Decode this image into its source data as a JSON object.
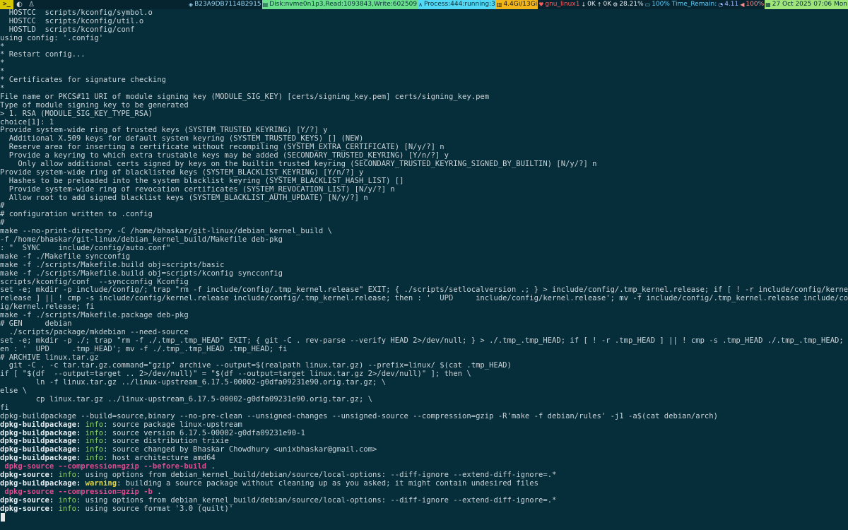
{
  "topbar": {
    "workspace": ">_",
    "status": {
      "host_id": "B23A9DB7114B2915",
      "disk": "Disk:nvme0n1p3,Read:1093843,Write:602509",
      "process": "Process:444:running:3",
      "memory": "4.4Gi/13Gi",
      "net_iface": "gnu_linux1",
      "net_down": "0K",
      "net_up": "0K",
      "cpu": "28.21%",
      "battery": "100% Time_Remain:",
      "load": "4.11",
      "volume": "100%",
      "datetime": "27 Oct 2025 07:06 Mon"
    }
  },
  "terminal": {
    "lines": [
      [
        {
          "t": "  HOSTCC  scripts/kconfig/symbol.o"
        }
      ],
      [
        {
          "t": "  HOSTCC  scripts/kconfig/util.o"
        }
      ],
      [
        {
          "t": "  HOSTLD  scripts/kconfig/conf"
        }
      ],
      [
        {
          "t": "using config: '.config'"
        }
      ],
      [
        {
          "t": "*"
        }
      ],
      [
        {
          "t": "* Restart config..."
        }
      ],
      [
        {
          "t": "*"
        }
      ],
      [
        {
          "t": "*"
        }
      ],
      [
        {
          "t": "* Certificates for signature checking"
        }
      ],
      [
        {
          "t": "*"
        }
      ],
      [
        {
          "t": "File name or PKCS#11 URI of module signing key (MODULE_SIG_KEY) [certs/signing_key.pem] certs/signing_key.pem"
        }
      ],
      [
        {
          "t": "Type of module signing key to be generated"
        }
      ],
      [
        {
          "t": "> 1. RSA (MODULE_SIG_KEY_TYPE_RSA)"
        }
      ],
      [
        {
          "t": "choice[1]: 1"
        }
      ],
      [
        {
          "t": "Provide system-wide ring of trusted keys (SYSTEM_TRUSTED_KEYRING) [Y/?] y"
        }
      ],
      [
        {
          "t": "  Additional X.509 keys for default system keyring (SYSTEM_TRUSTED_KEYS) [] (NEW)"
        }
      ],
      [
        {
          "t": "  Reserve area for inserting a certificate without recompiling (SYSTEM_EXTRA_CERTIFICATE) [N/y/?] n"
        }
      ],
      [
        {
          "t": "  Provide a keyring to which extra trustable keys may be added (SECONDARY_TRUSTED_KEYRING) [Y/n/?] y"
        }
      ],
      [
        {
          "t": "    Only allow additional certs signed by keys on the builtin trusted keyring (SECONDARY_TRUSTED_KEYRING_SIGNED_BY_BUILTIN) [N/y/?] n"
        }
      ],
      [
        {
          "t": "Provide system-wide ring of blacklisted keys (SYSTEM_BLACKLIST_KEYRING) [Y/n/?] y"
        }
      ],
      [
        {
          "t": "  Hashes to be preloaded into the system blacklist keyring (SYSTEM_BLACKLIST_HASH_LIST) []"
        }
      ],
      [
        {
          "t": "  Provide system-wide ring of revocation certificates (SYSTEM_REVOCATION_LIST) [N/y/?] n"
        }
      ],
      [
        {
          "t": "  Allow root to add signed blacklist keys (SYSTEM_BLACKLIST_AUTH_UPDATE) [N/y/?] n"
        }
      ],
      [
        {
          "t": "#"
        }
      ],
      [
        {
          "t": "# configuration written to .config"
        }
      ],
      [
        {
          "t": "#"
        }
      ],
      [
        {
          "t": "make --no-print-directory -C /home/bhaskar/git-linux/debian_kernel_build \\"
        }
      ],
      [
        {
          "t": "-f /home/bhaskar/git-linux/debian_kernel_build/Makefile deb-pkg"
        }
      ],
      [
        {
          "t": ": \"  SYNC    include/config/auto.conf\""
        }
      ],
      [
        {
          "t": "make -f ./Makefile syncconfig"
        }
      ],
      [
        {
          "t": "make -f ./scripts/Makefile.build obj=scripts/basic"
        }
      ],
      [
        {
          "t": "make -f ./scripts/Makefile.build obj=scripts/kconfig syncconfig"
        }
      ],
      [
        {
          "t": "scripts/kconfig/conf  --syncconfig Kconfig"
        }
      ],
      [
        {
          "t": "set -e; mkdir -p include/config/; trap \"rm -f include/config/.tmp_kernel.release\" EXIT; { ./scripts/setlocalversion .; } > include/config/.tmp_kernel.release; if [ ! -r include/config/kernel."
        }
      ],
      [
        {
          "t": "release ] || ! cmp -s include/config/kernel.release include/config/.tmp_kernel.release; then : '  UPD     include/config/kernel.release'; mv -f include/config/.tmp_kernel.release include/conf"
        }
      ],
      [
        {
          "t": "ig/kernel.release; fi"
        }
      ],
      [
        {
          "t": "make -f ./scripts/Makefile.package deb-pkg"
        }
      ],
      [
        {
          "t": "# GEN     debian"
        }
      ],
      [
        {
          "t": "  ./scripts/package/mkdebian --need-source"
        }
      ],
      [
        {
          "t": "set -e; mkdir -p ./; trap \"rm -f ./.tmp_.tmp_HEAD\" EXIT; { git -C . rev-parse --verify HEAD 2>/dev/null; } > ./.tmp_.tmp_HEAD; if [ ! -r .tmp_HEAD ] || ! cmp -s .tmp_HEAD ./.tmp_.tmp_HEAD; th"
        }
      ],
      [
        {
          "t": "en : '  UPD     .tmp_HEAD'; mv -f ./.tmp_.tmp_HEAD .tmp_HEAD; fi"
        }
      ],
      [
        {
          "t": "# ARCHIVE linux.tar.gz"
        }
      ],
      [
        {
          "t": "  git -C . -c tar.tar.gz.command=\"gzip\" archive --output=$(realpath linux.tar.gz) --prefix=linux/ $(cat .tmp_HEAD)"
        }
      ],
      [
        {
          "t": "if [ \"$(df  --output=target .. 2>/dev/null)\" = \"$(df --output=target linux.tar.gz 2>/dev/null)\" ]; then \\"
        }
      ],
      [
        {
          "t": "        ln -f linux.tar.gz ../linux-upstream_6.17.5-00002-g0dfa09231e90.orig.tar.gz; \\"
        }
      ],
      [
        {
          "t": "else \\"
        }
      ],
      [
        {
          "t": "        cp linux.tar.gz ../linux-upstream_6.17.5-00002-g0dfa09231e90.orig.tar.gz; \\"
        }
      ],
      [
        {
          "t": "fi"
        }
      ],
      [
        {
          "t": "dpkg-buildpackage --build=source,binary --no-pre-clean --unsigned-changes --unsigned-source --compression=gzip -R'make -f debian/rules' -j1 -a$(cat debian/arch)"
        }
      ],
      [
        {
          "t": "dpkg-buildpackage:",
          "s": "src"
        },
        {
          "t": " "
        },
        {
          "t": "info",
          "s": "info"
        },
        {
          "t": ": source package linux-upstream"
        }
      ],
      [
        {
          "t": "dpkg-buildpackage:",
          "s": "src"
        },
        {
          "t": " "
        },
        {
          "t": "info",
          "s": "info"
        },
        {
          "t": ": source version 6.17.5-00002-g0dfa09231e90-1"
        }
      ],
      [
        {
          "t": "dpkg-buildpackage:",
          "s": "src"
        },
        {
          "t": " "
        },
        {
          "t": "info",
          "s": "info"
        },
        {
          "t": ": source distribution trixie"
        }
      ],
      [
        {
          "t": "dpkg-buildpackage:",
          "s": "src"
        },
        {
          "t": " "
        },
        {
          "t": "info",
          "s": "info"
        },
        {
          "t": ": source changed by Bhaskar Chowdhury <unixbhaskar@gmail.com>"
        }
      ],
      [
        {
          "t": "dpkg-buildpackage:",
          "s": "src"
        },
        {
          "t": " "
        },
        {
          "t": "info",
          "s": "info"
        },
        {
          "t": ": host architecture amd64"
        }
      ],
      [
        {
          "t": " "
        },
        {
          "t": "dpkg-source --compression=gzip --before-build",
          "s": "cmd"
        },
        {
          "t": " ."
        }
      ],
      [
        {
          "t": "dpkg-source:",
          "s": "src"
        },
        {
          "t": " "
        },
        {
          "t": "info",
          "s": "info"
        },
        {
          "t": ": using options from debian_kernel_build/debian/source/local-options: --diff-ignore --extend-diff-ignore=.*"
        }
      ],
      [
        {
          "t": "dpkg-buildpackage:",
          "s": "src"
        },
        {
          "t": " "
        },
        {
          "t": "warning",
          "s": "warn"
        },
        {
          "t": ": building a source package without cleaning up as you asked; it might contain undesired files"
        }
      ],
      [
        {
          "t": " "
        },
        {
          "t": "dpkg-source --compression=gzip -b",
          "s": "cmd"
        },
        {
          "t": " ."
        }
      ],
      [
        {
          "t": "dpkg-source:",
          "s": "src"
        },
        {
          "t": " "
        },
        {
          "t": "info",
          "s": "info"
        },
        {
          "t": ": using options from debian_kernel_build/debian/source/local-options: --diff-ignore --extend-diff-ignore=.*"
        }
      ],
      [
        {
          "t": "dpkg-source:",
          "s": "src"
        },
        {
          "t": " "
        },
        {
          "t": "info",
          "s": "info"
        },
        {
          "t": ": using source format '3.0 (quilt)'"
        }
      ]
    ]
  }
}
